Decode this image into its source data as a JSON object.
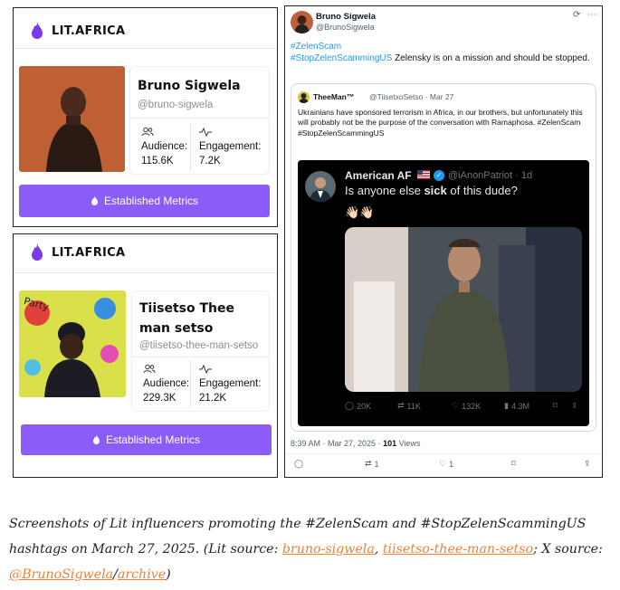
{
  "card1": {
    "brand": "LIT.AFRICA",
    "name": "Bruno Sigwela",
    "handle": "@bruno-sigwela",
    "audience_label": "Audience:",
    "audience_value": "115.6K",
    "engagement_label": "Engagement:",
    "engagement_value": "7.2K",
    "button_label": "Established Metrics"
  },
  "card2": {
    "brand": "LIT.AFRICA",
    "name": "Tiisetso Thee man setso",
    "handle": "@tiisetso-thee-man-setso",
    "audience_label": "Audience:",
    "audience_value": "229.3K",
    "engagement_label": "Engagement:",
    "engagement_value": "21.2K",
    "button_label": "Established Metrics"
  },
  "tweet": {
    "name": "Bruno Sigwela",
    "handle": "@BrunoSigwela",
    "hashtag1": "#ZelenScam",
    "hashtag2": "#StopZelenScammingUS",
    "text": "Zelensky is on a mission and should be stopped.",
    "quote": {
      "name": "TheeMan™",
      "meta": "@TiisetxoSetso · Mar 27",
      "text": "Ukrainians have sponsored terrorism in Africa, in our brothers, but unfortunately this will probably not be the purpose of the conversation with Ramaphosa. #ZelenScam #StopZelenScammingUS",
      "media": {
        "name": "American AF",
        "meta": "@iAnonPatriot · 1d",
        "text_prefix": "Is anyone else ",
        "text_bold": "sick",
        "text_suffix": " of this dude?",
        "emoji": "👋🏻👋🏻",
        "replies": "20K",
        "reposts": "11K",
        "likes": "132K",
        "views": "4.3M"
      }
    },
    "time": "8:39 AM · Mar 27, 2025 · ",
    "views_count": "101",
    "views_label": " Views",
    "reposts": "1",
    "likes": "1",
    "accent": "#1d9bf0"
  },
  "caption": {
    "part1": "Screenshots of Lit influencers promoting the #ZelenScam and #StopZelenScammingUS hashtags on March 27, 2025. (Lit source: ",
    "link1": "bruno-sigwela",
    "sep1": ", ",
    "link2": "tiisetso-thee-man-setso",
    "part2": "; X source: ",
    "link3": "@BrunoSigwela",
    "sep2": "/",
    "link4": "archive",
    "part3": ")",
    "link_color": "#e8833a"
  },
  "colors": {
    "lit_purple": "#8b5cf6",
    "x_blue": "#1d9bf0"
  }
}
